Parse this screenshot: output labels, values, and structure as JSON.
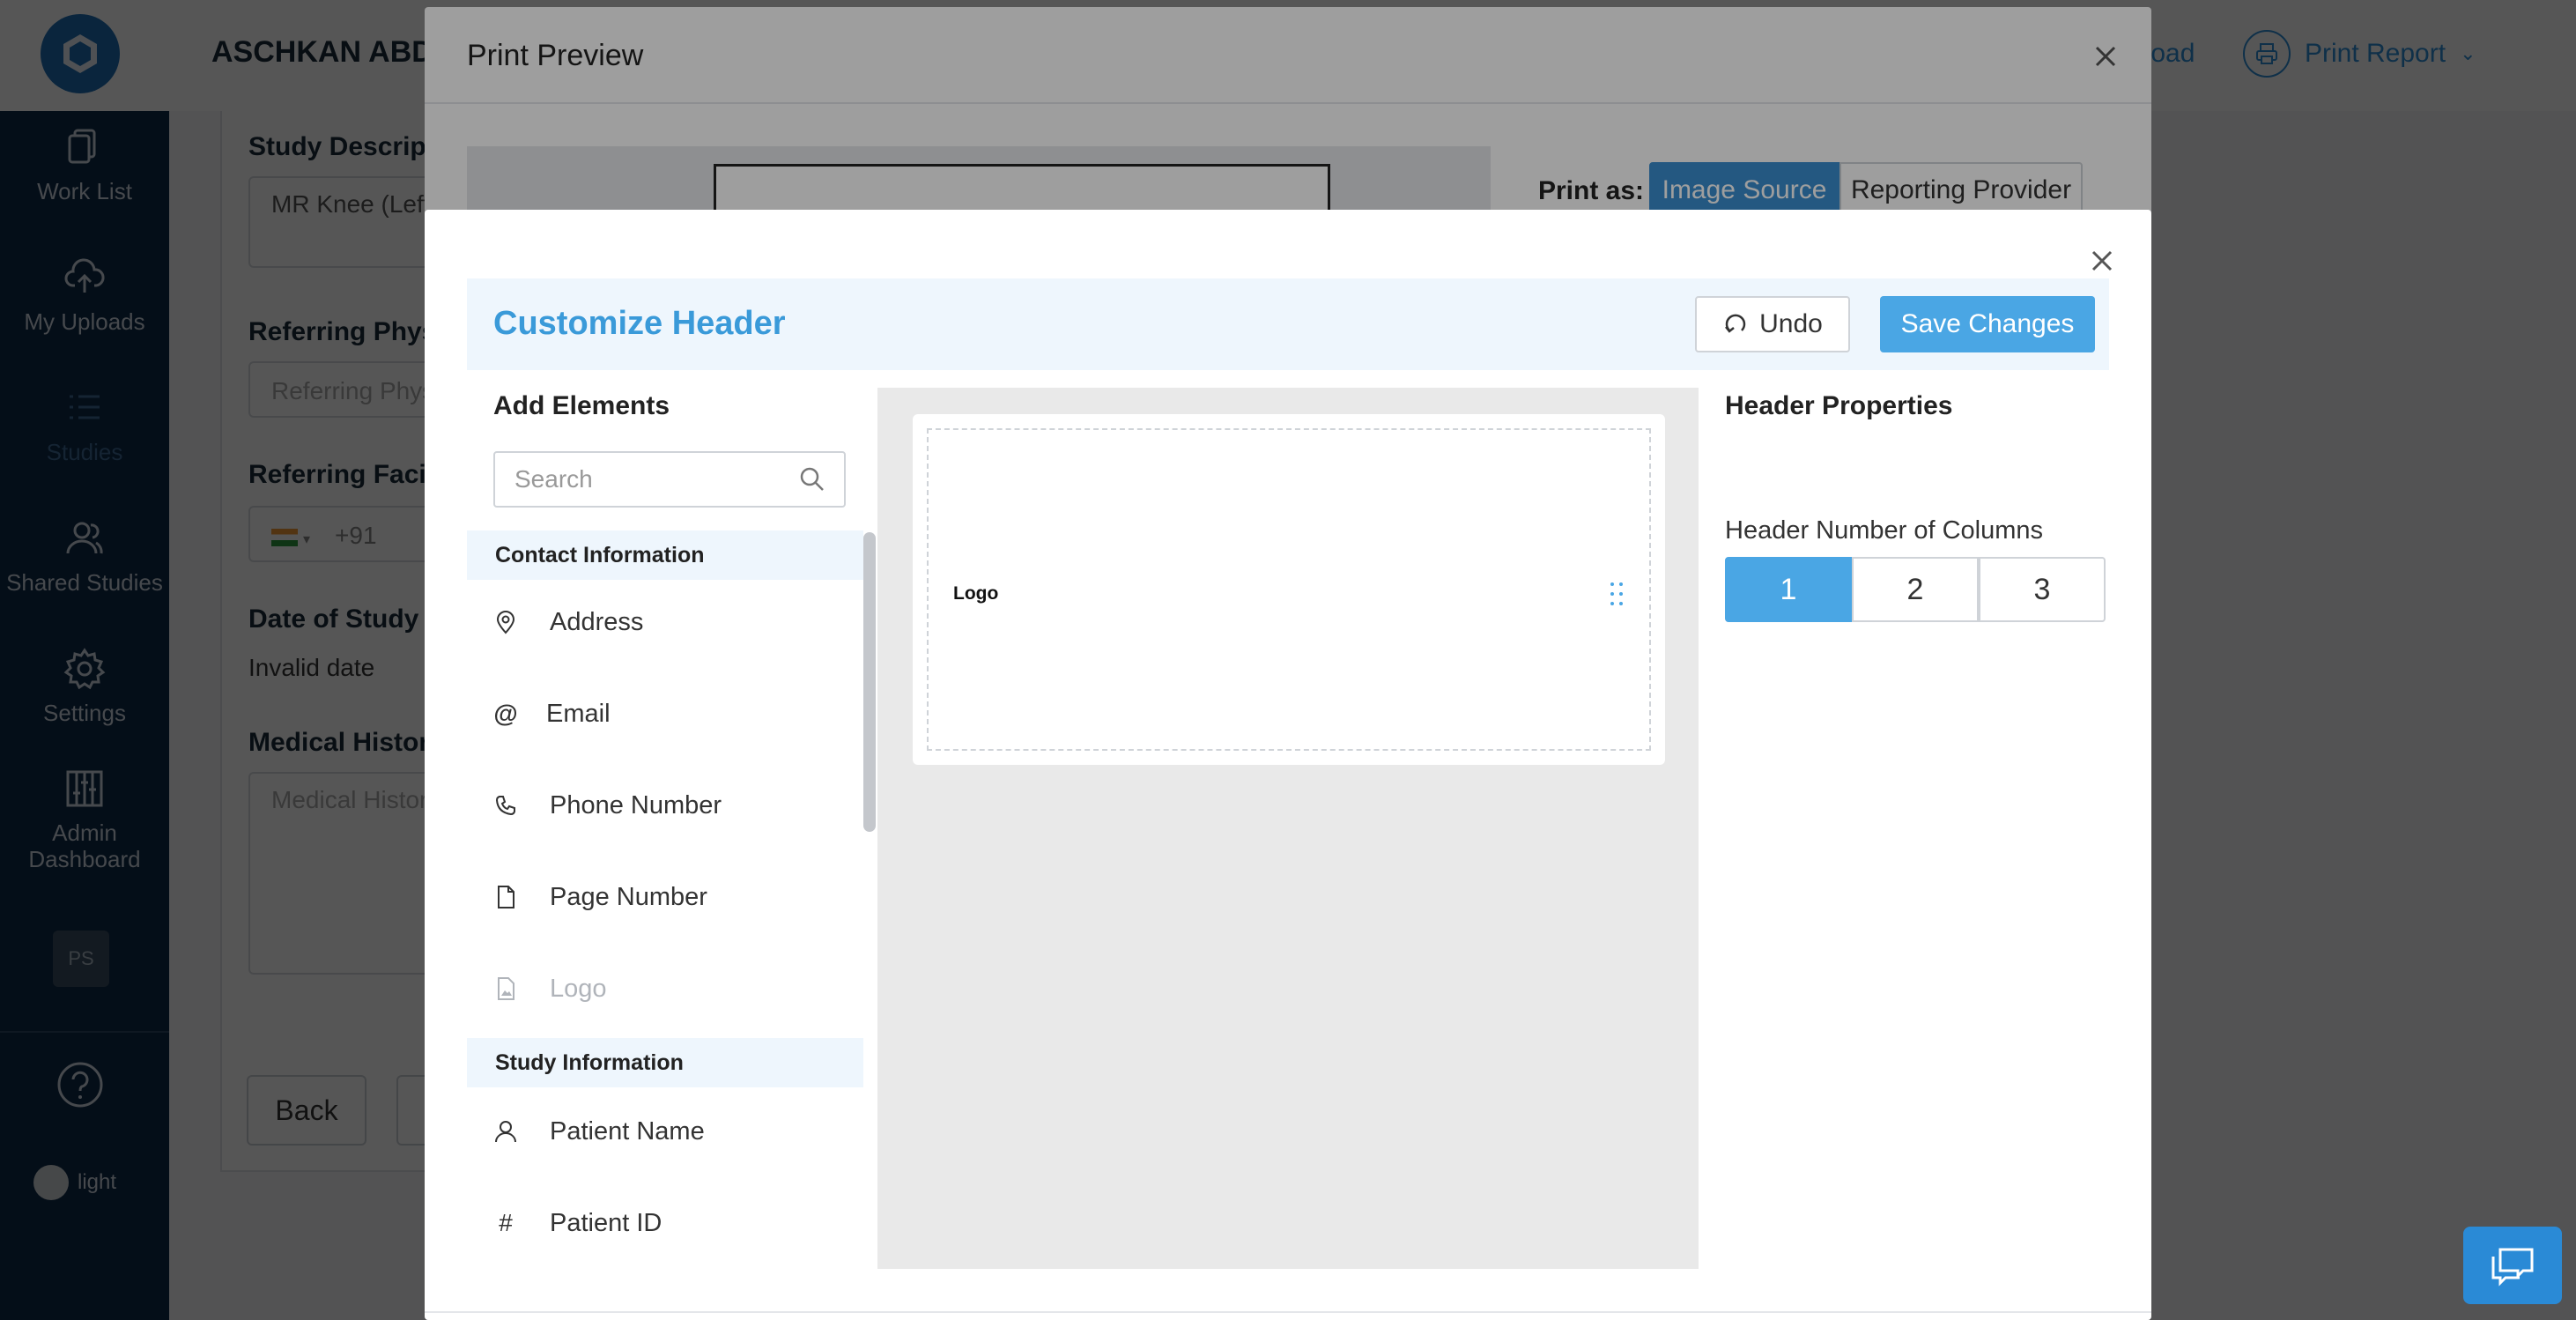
{
  "sidebar": {
    "items": [
      {
        "label": "Work List",
        "icon": "document-icon"
      },
      {
        "label": "My Uploads",
        "icon": "cloud-upload-icon"
      },
      {
        "label": "Studies",
        "icon": "list-icon"
      },
      {
        "label": "Shared Studies",
        "icon": "users-icon"
      },
      {
        "label": "Settings",
        "icon": "gear-icon"
      },
      {
        "label": "Admin Dashboard",
        "icon": "sliders-icon"
      }
    ],
    "user_badge": "PS",
    "theme_toggle_label": "light"
  },
  "topbar": {
    "patient_name": "ASCHKAN ABDU",
    "download_label": "nload",
    "print_report_label": "Print Report"
  },
  "study_form": {
    "study_description_label": "Study Descript",
    "study_description_value": "MR Knee (Left",
    "referring_physician_label": "Referring Phys",
    "referring_physician_placeholder": "Referring Phys",
    "referring_facility_label": "Referring Facili",
    "phone_code": "+91",
    "date_of_study_label": "Date of Study",
    "date_of_study_value": "Invalid date",
    "medical_history_label": "Medical History",
    "medical_history_placeholder": "Medical Histor",
    "back_label": "Back"
  },
  "print_preview": {
    "title": "Print Preview",
    "print_as_label": "Print as:",
    "print_as_options": [
      "Image Source",
      "Reporting Provider"
    ],
    "print_as_selected": "Image Source"
  },
  "customize_header": {
    "title": "Customize Header",
    "undo_label": "Undo",
    "save_label": "Save Changes",
    "add_elements_title": "Add Elements",
    "search_placeholder": "Search",
    "groups": [
      {
        "title": "Contact Information",
        "items": [
          {
            "label": "Address",
            "icon": "map-pin-icon",
            "enabled": true
          },
          {
            "label": "Email",
            "icon": "at-sign-icon",
            "enabled": true
          },
          {
            "label": "Phone Number",
            "icon": "phone-icon",
            "enabled": true
          },
          {
            "label": "Page Number",
            "icon": "file-icon",
            "enabled": true
          },
          {
            "label": "Logo",
            "icon": "image-file-icon",
            "enabled": false
          }
        ]
      },
      {
        "title": "Study Information",
        "items": [
          {
            "label": "Patient Name",
            "icon": "user-icon",
            "enabled": true
          },
          {
            "label": "Patient ID",
            "icon": "hash-icon",
            "enabled": true
          }
        ]
      }
    ],
    "canvas": {
      "element_label": "Logo"
    },
    "properties": {
      "title": "Header Properties",
      "columns_label": "Header Number of Columns",
      "column_options": [
        "1",
        "2",
        "3"
      ],
      "selected_columns": "1"
    }
  },
  "colors": {
    "sidebar_bg": "#0f2a47",
    "accent": "#4aa6e4",
    "title_blue": "#3a9ad9"
  }
}
